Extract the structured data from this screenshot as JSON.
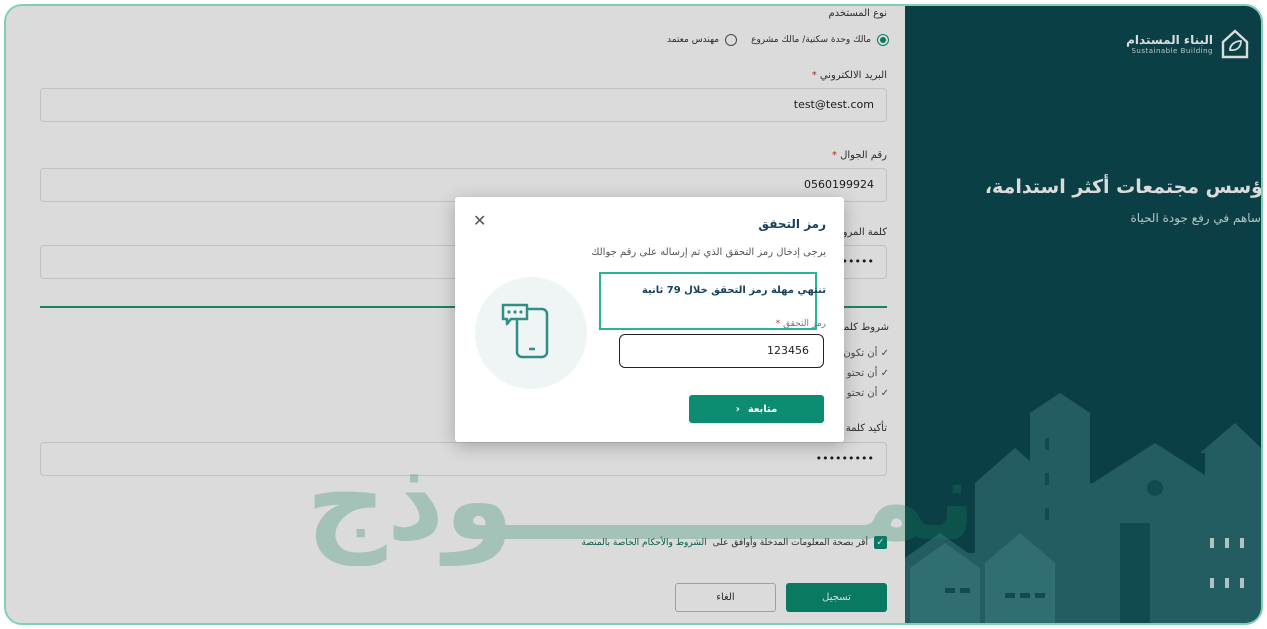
{
  "brand": {
    "name_ar": "البناء المستدام",
    "name_en": "Sustainable Building",
    "headline": "ؤسس مجتمعات أكثر استدامة،",
    "subline": "ساهم في رفع جودة الحياة",
    "panel_color": "#0d4a52"
  },
  "form": {
    "user_type_label": "نوع المستخدم",
    "user_type_options": [
      {
        "label": "مالك وحدة سكنية/ مالك مشروع",
        "selected": true
      },
      {
        "label": "مهندس معتمد",
        "selected": false
      }
    ],
    "email_label": "البريد الالكتروني",
    "email_value": "test@test.com",
    "phone_label": "رقم الجوال",
    "phone_value": "0560199924",
    "password_label": "كلمة المرور",
    "password_value": "•••••••••",
    "rules_title": "شروط كلمة",
    "rules": [
      "أن تكون",
      "أن تحتو",
      "أن تحتو"
    ],
    "confirm_label": "تأكيد كلمة",
    "confirm_value": "•••••••••",
    "required_mark": "*",
    "terms_prefix": "أقر بصحة المعلومات المدخلة وأوافق على",
    "terms_link": "الشروط والأحكام الخاصة بالمنصة",
    "register_label": "تسجيل",
    "cancel_label": "الغاء",
    "accent_color": "#0c8d72"
  },
  "watermark": "نمـــــــــوذج",
  "modal": {
    "title": "رمز التحقق",
    "description": "يرجى إدخال رمز التحقق الذي تم إرساله على رقم جوالك",
    "timer_text": "تنتهي مهلة رمز التحقق خلال 79 ثانية",
    "code_label": "رمز التحقق",
    "code_value": "123456",
    "continue_label": "متابعة",
    "close_icon": "close-icon",
    "chevron_icon": "chevron-left-icon",
    "illustration_icon": "phone-message-icon"
  }
}
